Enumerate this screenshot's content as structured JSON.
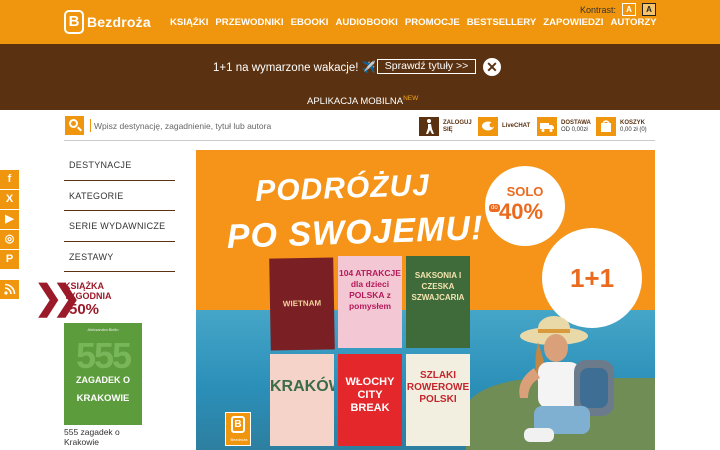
{
  "header": {
    "logo_letter": "B",
    "logo_text": "Bezdroża",
    "nav": [
      "KSIĄŻKI",
      "PRZEWODNIKI",
      "EBOOKI",
      "AUDIOBOOKI",
      "PROMOCJE",
      "BESTSELLERY",
      "ZAPOWIEDZI",
      "AUTORZY"
    ],
    "contrast_label": "Kontrast:",
    "contrast_options": [
      "A",
      "A"
    ]
  },
  "promo": {
    "text": "1+1 na wymarzone wakacje! ✈️",
    "button": "Sprawdź tytuły >>",
    "close": "✕",
    "app_link": "APLIKACJA MOBILNA",
    "app_badge": "NEW"
  },
  "search": {
    "placeholder": "Wpisz destynację, zagadnienie, tytuł lub autora"
  },
  "utilities": {
    "login": {
      "line1": "ZALOGUJ",
      "line2": "SIĘ"
    },
    "livechat": {
      "line1": "LiveCHAT"
    },
    "delivery": {
      "line1": "DOSTAWA",
      "line2": "OD 0,00zł"
    },
    "cart": {
      "line1": "KOSZYK",
      "line2": "0,00 zł (0)"
    }
  },
  "categories": [
    "DESTYNACJE",
    "KATEGORIE",
    "SERIE WYDAWNICZE",
    "ZESTAWY"
  ],
  "social": [
    "f",
    "X",
    "▶",
    "◎",
    "P"
  ],
  "book_of_week": {
    "title_line1": "KSIĄŻKA",
    "title_line2": "TYGODNIA",
    "discount": "-50%",
    "cover_author": "Aleksandra Bielin",
    "cover_number": "555",
    "cover_line1": "ZAGADEK O",
    "cover_line2": "KRAKOWIE",
    "name": "555 zagadek o Krakowie"
  },
  "hero": {
    "title_line1": "PODRÓŻUJ",
    "title_line2": "PO SWOJEMU!",
    "solo_label": "SOLO",
    "solo_do": "do",
    "solo_pct": "40%",
    "deal": "1+1",
    "books": [
      {
        "title": "WIETNAM",
        "color": "#7a1f24",
        "text_color": "#f3d39a"
      },
      {
        "title": "104 ATRAKCJE dla dzieci POLSKA z pomysłem",
        "color": "#f4c7d4",
        "text_color": "#b31b5a"
      },
      {
        "title": "SAKSONIA I CZESKA SZWAJCARIA",
        "color": "#3f6b3a",
        "text_color": "#f4e4b0"
      },
      {
        "title": "KRAKÓW",
        "color": "#f6d3c8",
        "text_color": "#3a6b4a"
      },
      {
        "title": "WŁOCHY CITY BREAK",
        "color": "#e4272b",
        "text_color": "#fff"
      },
      {
        "title": "SZLAKI ROWEROWE POLSKI",
        "color": "#f3efe0",
        "text_color": "#c3262d"
      }
    ],
    "logo_letter": "B",
    "logo_text": "Bezdroża"
  }
}
